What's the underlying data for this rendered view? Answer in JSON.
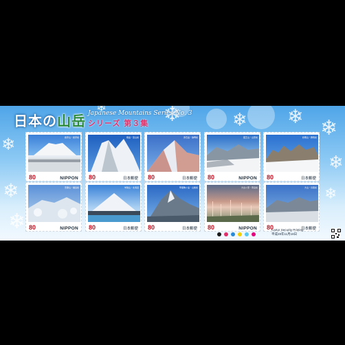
{
  "sheet": {
    "title_part1": "日本の",
    "title_part2": "山岳",
    "subtitle_en": "Japanese Mountains Series No. 3",
    "subtitle_jp": "シリーズ 第３集",
    "printer": "Cartor Security Printing",
    "printer_date": "平成28年11月18日"
  },
  "stamps": [
    {
      "value": "80",
      "country": "NIPPON",
      "caption": "岩手山・岩手県"
    },
    {
      "value": "80",
      "country": "日本郵便",
      "caption": "剱岳・富山県"
    },
    {
      "value": "80",
      "country": "日本郵便",
      "caption": "赤石岳・静岡県"
    },
    {
      "value": "80",
      "country": "NIPPON",
      "caption": "蔵王山・山形県"
    },
    {
      "value": "80",
      "country": "日本郵便",
      "caption": "妙義山・群馬県"
    },
    {
      "value": "80",
      "country": "NIPPON",
      "caption": "吾妻山・福島県"
    },
    {
      "value": "80",
      "country": "日本郵便",
      "caption": "羊蹄山・北海道"
    },
    {
      "value": "80",
      "country": "日本郵便",
      "caption": "甲斐駒ヶ岳・山梨県"
    },
    {
      "value": "80",
      "country": "NIPPON",
      "caption": "大台ヶ原・奈良県"
    },
    {
      "value": "80",
      "country": "日本郵便",
      "caption": "大山・鳥取県"
    }
  ],
  "colors": {
    "sky_top": "#4fa5e8",
    "sky_bottom": "#f3f9ff",
    "value_red": "#c01020",
    "series_pink": "#e0306a",
    "title_green": "#2a8a3a"
  },
  "swatches": [
    "#1a1a1a",
    "#e0306a",
    "#2a8ad8",
    "#f2d000",
    "#5ac8f0",
    "#e6007e"
  ]
}
